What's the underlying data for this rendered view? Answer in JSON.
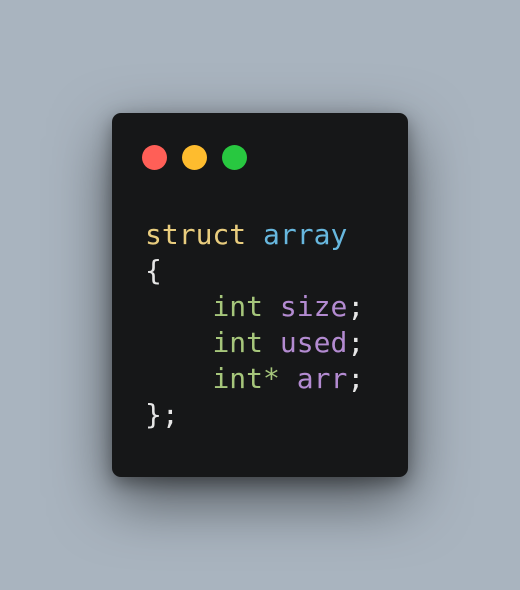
{
  "window": {
    "controls": [
      {
        "name": "close",
        "color": "#ff5f57"
      },
      {
        "name": "minimize",
        "color": "#febc2e"
      },
      {
        "name": "maximize",
        "color": "#28c840"
      }
    ]
  },
  "code": {
    "colors": {
      "keyword": "#e9cd7e",
      "type_name": "#67b7de",
      "type": "#a6c67b",
      "identifier": "#b38bd1",
      "punctuation": "#e6e6e6"
    },
    "lines": [
      [
        {
          "text": "struct",
          "kind": "keyword"
        },
        {
          "text": " ",
          "kind": "punctuation"
        },
        {
          "text": "array",
          "kind": "type_name"
        }
      ],
      [
        {
          "text": "{",
          "kind": "punctuation"
        }
      ],
      [
        {
          "text": "    ",
          "kind": "punctuation"
        },
        {
          "text": "int",
          "kind": "type"
        },
        {
          "text": " ",
          "kind": "punctuation"
        },
        {
          "text": "size",
          "kind": "identifier"
        },
        {
          "text": ";",
          "kind": "punctuation"
        }
      ],
      [
        {
          "text": "    ",
          "kind": "punctuation"
        },
        {
          "text": "int",
          "kind": "type"
        },
        {
          "text": " ",
          "kind": "punctuation"
        },
        {
          "text": "used",
          "kind": "identifier"
        },
        {
          "text": ";",
          "kind": "punctuation"
        }
      ],
      [
        {
          "text": "    ",
          "kind": "punctuation"
        },
        {
          "text": "int*",
          "kind": "type"
        },
        {
          "text": " ",
          "kind": "punctuation"
        },
        {
          "text": "arr",
          "kind": "identifier"
        },
        {
          "text": ";",
          "kind": "punctuation"
        }
      ],
      [
        {
          "text": "};",
          "kind": "punctuation"
        }
      ]
    ]
  }
}
